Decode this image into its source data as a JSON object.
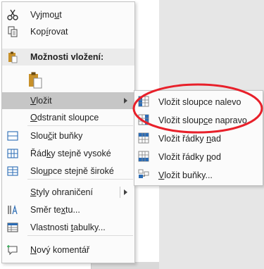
{
  "menu": {
    "cut": {
      "pre": "Vyjmo",
      "acc": "u",
      "post": "t",
      "icon": "scissors-icon"
    },
    "copy": {
      "pre": "Kop",
      "acc": "í",
      "post": "rovat",
      "icon": "copy-icon"
    },
    "paste_header": {
      "label": "Možnosti vložení:",
      "icon": "clipboard-icon"
    },
    "paste_option": {
      "icon": "clipboard-paste-icon"
    },
    "insert": {
      "pre": "",
      "acc": "V",
      "post": "ložit"
    },
    "delete_column": {
      "pre": "",
      "acc": "O",
      "post": "dstranit sloupce"
    },
    "merge_cells": {
      "pre": "Slou",
      "acc": "č",
      "post": "it buňky",
      "icon": "merge-cells-icon"
    },
    "distribute_rows": {
      "pre": "Řád",
      "acc": "k",
      "post": "y stejně vysoké",
      "icon": "distribute-rows-icon"
    },
    "distribute_columns": {
      "pre": "Slo",
      "acc": "u",
      "post": "pce stejně široké",
      "icon": "distribute-columns-icon"
    },
    "border_styles": {
      "pre": "",
      "acc": "S",
      "post": "tyly ohraničení"
    },
    "text_direction": {
      "pre": "Směr te",
      "acc": "x",
      "post": "tu...",
      "icon": "text-direction-icon"
    },
    "table_properties": {
      "pre": "Vlastnosti ",
      "acc": "t",
      "post": "abulky...",
      "icon": "table-properties-icon"
    },
    "new_comment": {
      "pre": "",
      "acc": "N",
      "post": "ový komentář",
      "icon": "new-comment-icon"
    }
  },
  "submenu": {
    "insert_columns_left": {
      "pre": "Vložit sloupce nalevo",
      "acc": "",
      "post": ""
    },
    "insert_columns_right": {
      "pre": "Vložit sloup",
      "acc": "c",
      "post": "e napravo"
    },
    "insert_rows_above": {
      "pre": "Vložit řádky ",
      "acc": "n",
      "post": "ad"
    },
    "insert_rows_below": {
      "pre": "Vložit řádky ",
      "acc": "p",
      "post": "od"
    },
    "insert_cells": {
      "pre": "",
      "acc": "V",
      "post": "ložit buňky..."
    }
  },
  "colors": {
    "highlight": "#c6c6c6",
    "annotation": "#e8202a",
    "icon_blue": "#2b6cb5",
    "clipboard": "#c8912a"
  }
}
